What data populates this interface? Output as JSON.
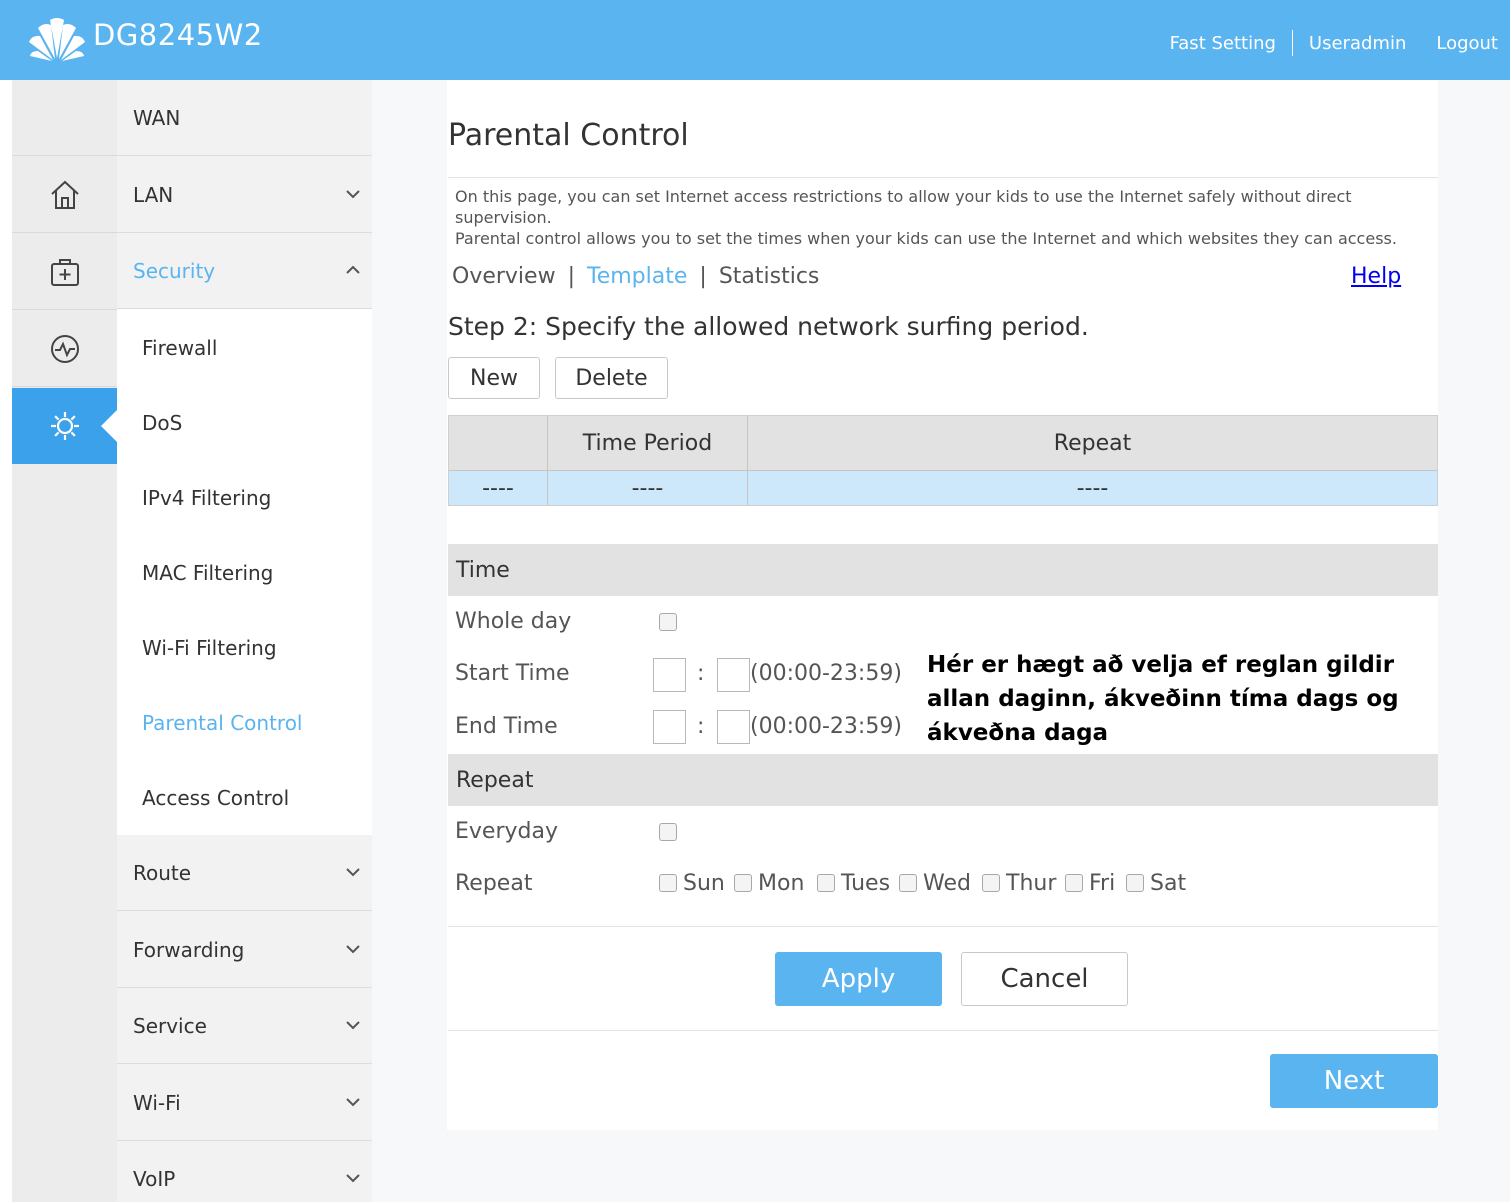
{
  "header": {
    "model": "DG8245W2",
    "links": {
      "fast_setting": "Fast Setting",
      "useradmin": "Useradmin",
      "logout": "Logout"
    }
  },
  "rail": {
    "icons": [
      "home-icon",
      "medical-kit-icon",
      "monitor-pulse-icon",
      "gear-icon"
    ],
    "active": "gear-icon"
  },
  "menu": {
    "wan": "WAN",
    "lan": "LAN",
    "security": "Security",
    "security_items": [
      "Firewall",
      "DoS",
      "IPv4 Filtering",
      "MAC Filtering",
      "Wi-Fi Filtering",
      "Parental Control",
      "Access Control"
    ],
    "active_item": "Parental Control",
    "route": "Route",
    "forwarding": "Forwarding",
    "service": "Service",
    "wifi": "Wi-Fi",
    "voip": "VoIP"
  },
  "page": {
    "title": "Parental Control",
    "desc_line1": "On this page, you can set Internet access restrictions to allow your kids to use the Internet safely without direct supervision.",
    "desc_line2": "Parental control allows you to set the times when your kids can use the Internet and which websites they can access.",
    "tabs": {
      "overview": "Overview",
      "template": "Template",
      "statistics": "Statistics"
    },
    "active_tab": "Template",
    "help": "Help",
    "step": "Step 2: Specify the allowed network surfing period."
  },
  "toolbar": {
    "new_label": "New",
    "delete_label": "Delete"
  },
  "table": {
    "headers": [
      "",
      "Time Period",
      "Repeat"
    ],
    "row": [
      "----",
      "----",
      "----"
    ]
  },
  "time": {
    "section": "Time",
    "whole_day": "Whole day",
    "start_time": "Start Time",
    "end_time": "End Time",
    "colon": ":",
    "range": "(00:00-23:59)"
  },
  "repeat": {
    "section": "Repeat",
    "everyday": "Everyday",
    "repeat_label": "Repeat",
    "days": [
      "Sun",
      "Mon",
      "Tues",
      "Wed",
      "Thur",
      "Fri",
      "Sat"
    ]
  },
  "annotation": {
    "line1": "Hér er hægt að velja ef reglan gildir",
    "line2": "allan daginn, ákveðinn tíma dags og",
    "line3": "ákveðna daga"
  },
  "actions": {
    "apply": "Apply",
    "cancel": "Cancel",
    "next": "Next"
  },
  "colors": {
    "header": "#5ab4f0",
    "accent": "#5ab4f0",
    "active_rail": "#3aa1ea",
    "row_highlight": "#cde8fb"
  }
}
